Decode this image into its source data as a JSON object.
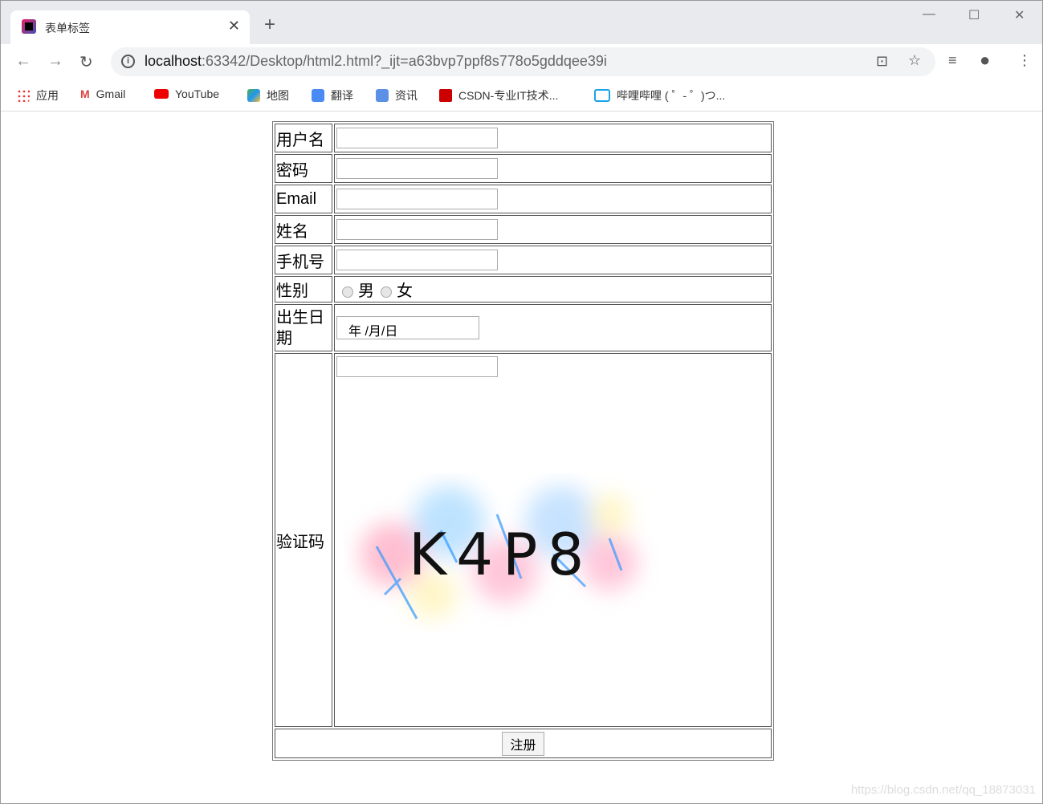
{
  "browser": {
    "tab_title": "表单标签",
    "url_host": "localhost",
    "url_rest": ":63342/Desktop/html2.html?_ijt=a63bvp7ppf8s778o5gddqee39i",
    "bookmarks": [
      "应用",
      "Gmail",
      "YouTube",
      "地图",
      "翻译",
      "资讯",
      "CSDN-专业IT技术...",
      "哔哩哔哩 ( ゜- ゜)つ..."
    ]
  },
  "form": {
    "username_label": "用户名",
    "password_label": "密码",
    "email_label": "Email",
    "name_label": "姓名",
    "phone_label": "手机号",
    "gender_label": "性别",
    "gender_options": [
      "男",
      "女"
    ],
    "birth_label": "出生日期",
    "date_placeholder": "年 /月/日",
    "captcha_label": "验证码",
    "captcha_text": "K4P8",
    "submit_label": "注册"
  },
  "watermark": "https://blog.csdn.net/qq_18873031"
}
